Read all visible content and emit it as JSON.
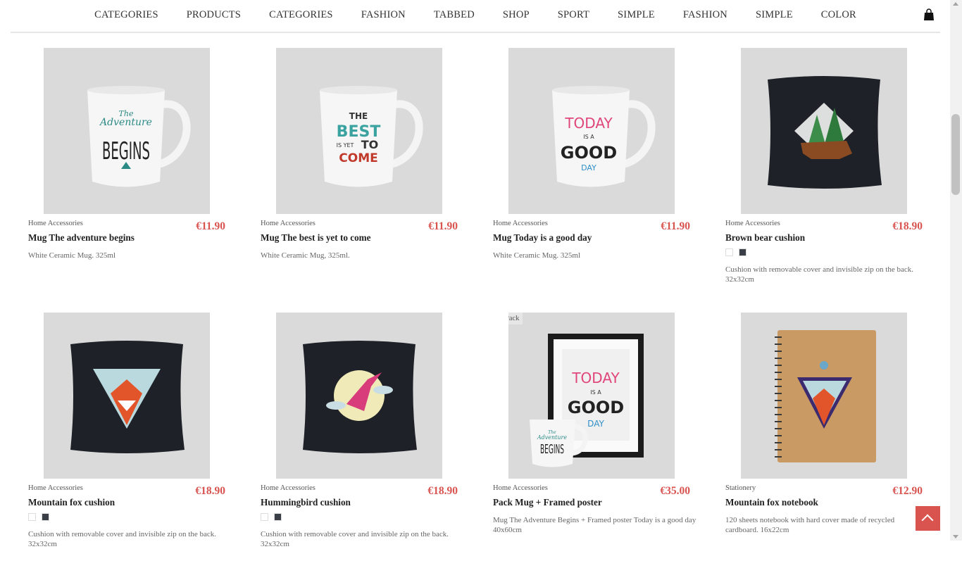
{
  "nav": {
    "items": [
      "CATEGORIES",
      "PRODUCTS",
      "CATEGORIES",
      "FASHION",
      "TABBED",
      "SHOP",
      "SPORT",
      "SIMPLE",
      "FASHION",
      "SIMPLE",
      "COLOR"
    ],
    "cart_icon": "shopping-bag-icon"
  },
  "products": [
    {
      "category": "Home Accessories",
      "price": "€11.90",
      "name": "Mug The adventure begins",
      "desc": "White Ceramic Mug. 325ml",
      "art": [
        "The",
        "Adventure",
        "BEGINS"
      ]
    },
    {
      "category": "Home Accessories",
      "price": "€11.90",
      "name": "Mug The best is yet to come",
      "desc": "White Ceramic Mug, 325ml.",
      "art": [
        "THE",
        "BEST",
        "IS YET",
        "TO",
        "COME"
      ]
    },
    {
      "category": "Home Accessories",
      "price": "€11.90",
      "name": "Mug Today is a good day",
      "desc": "White Ceramic Mug. 325ml",
      "art": [
        "TODAY",
        "IS A",
        "GOOD",
        "DAY"
      ]
    },
    {
      "category": "Home Accessories",
      "price": "€18.90",
      "name": "Brown bear cushion",
      "desc": "Cushion with removable cover and invisible zip on the back. 32x32cm",
      "swatches": [
        "#ffffff",
        "#3a3f47"
      ]
    },
    {
      "category": "Home Accessories",
      "price": "€18.90",
      "name": "Mountain fox cushion",
      "desc": "Cushion with removable cover and invisible zip on the back. 32x32cm",
      "swatches": [
        "#ffffff",
        "#3a3f47"
      ]
    },
    {
      "category": "Home Accessories",
      "price": "€18.90",
      "name": "Hummingbird cushion",
      "desc": "Cushion with removable cover and invisible zip on the back. 32x32cm",
      "swatches": [
        "#ffffff",
        "#3a3f47"
      ]
    },
    {
      "category": "Home Accessories",
      "price": "€35.00",
      "name": "Pack Mug + Framed poster",
      "desc": "Mug The Adventure Begins + Framed poster Today is a good day 40x60cm",
      "badge": "Pack",
      "art": [
        "TODAY",
        "IS A",
        "GOOD",
        "DAY",
        "The",
        "Adventure",
        "BEGINS"
      ]
    },
    {
      "category": "Stationery",
      "price": "€12.90",
      "name": "Mountain fox notebook",
      "desc": "120 sheets notebook with hard cover made of recycled cardboard. 16x22cm"
    }
  ],
  "colors": {
    "accent": "#d9534f",
    "thumb_bg": "#dadada"
  }
}
